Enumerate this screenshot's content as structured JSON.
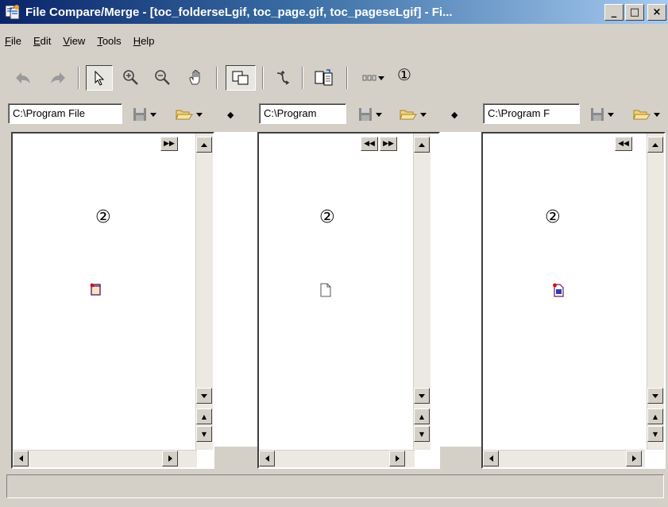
{
  "window": {
    "title": "File Compare/Merge - [toc_folderseLgif, toc_page.gif, toc_pageseLgif] - Fi...",
    "minimize_label": "_",
    "maximize_label": "□",
    "close_label": "×"
  },
  "menu": {
    "items": [
      {
        "label": "File"
      },
      {
        "label": "Edit"
      },
      {
        "label": "View"
      },
      {
        "label": "Tools"
      },
      {
        "label": "Help"
      }
    ]
  },
  "toolbar": {
    "callout": "①"
  },
  "panes": [
    {
      "path": "C:\\Program File",
      "callout": "②",
      "icon": "folder-selected-file-icon"
    },
    {
      "path": "C:\\Program",
      "callout": "②",
      "icon": "page-file-icon"
    },
    {
      "path": "C:\\Program F",
      "callout": "②",
      "icon": "page-selected-file-icon"
    }
  ],
  "status": {
    "text": ""
  },
  "colors": {
    "title_start": "#0a246a",
    "title_end": "#a6caf0",
    "chrome": "#d4d0c8",
    "accent_red": "#cc1111",
    "accent_blue": "#2b3fb5"
  }
}
